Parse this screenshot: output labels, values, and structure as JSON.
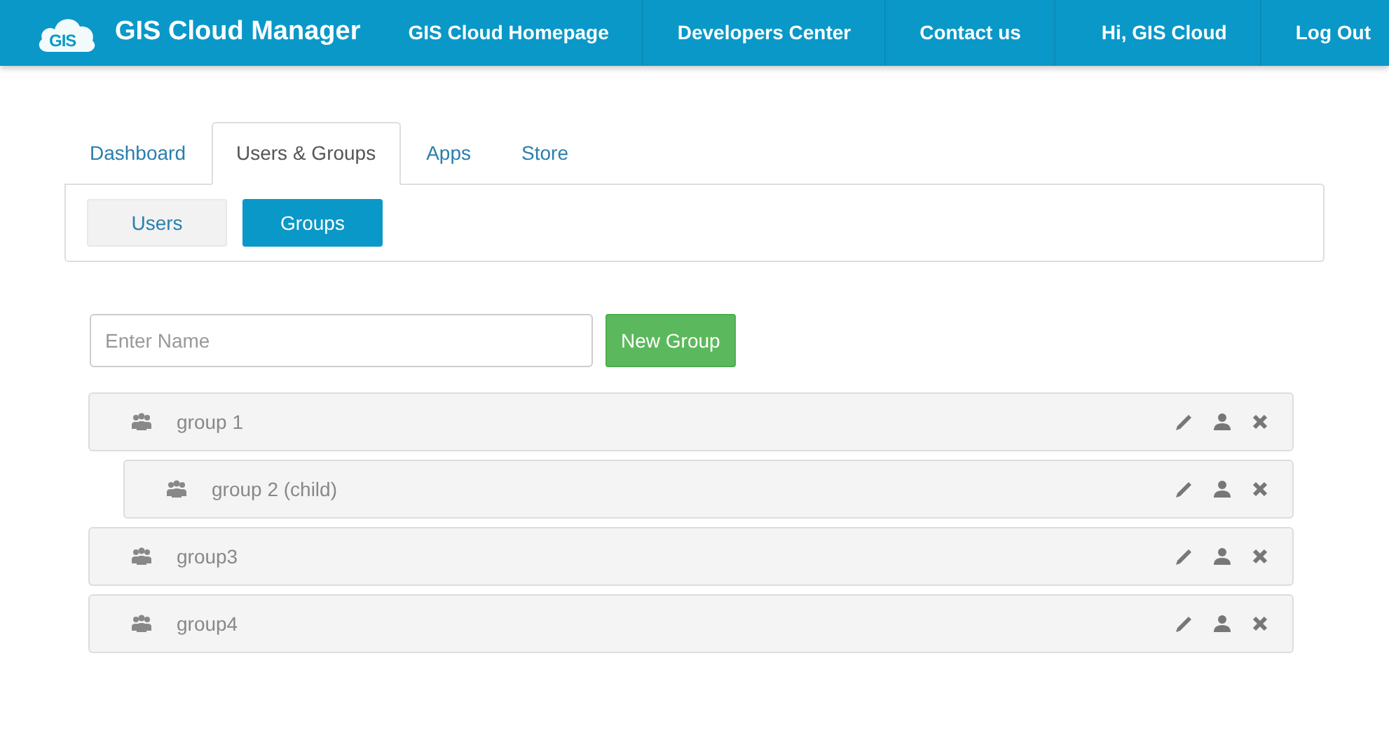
{
  "navbar": {
    "logo_text": "GIS",
    "brand": "GIS Cloud Manager",
    "links": [
      "GIS Cloud Homepage",
      "Developers Center",
      "Contact us"
    ],
    "right_links": [
      "Hi, GIS Cloud",
      "Log Out"
    ]
  },
  "tabs": [
    {
      "label": "Dashboard",
      "selected": false
    },
    {
      "label": "Users & Groups",
      "selected": true
    },
    {
      "label": "Apps",
      "selected": false
    },
    {
      "label": "Store",
      "selected": false
    }
  ],
  "subtabs": [
    {
      "label": "Users",
      "selected": false
    },
    {
      "label": "Groups",
      "selected": true
    }
  ],
  "new_group": {
    "placeholder": "Enter Name",
    "button": "New Group"
  },
  "groups": [
    {
      "name": "group 1",
      "children": [
        {
          "name": "group 2 (child)"
        }
      ]
    },
    {
      "name": "group3"
    },
    {
      "name": "group4"
    }
  ]
}
